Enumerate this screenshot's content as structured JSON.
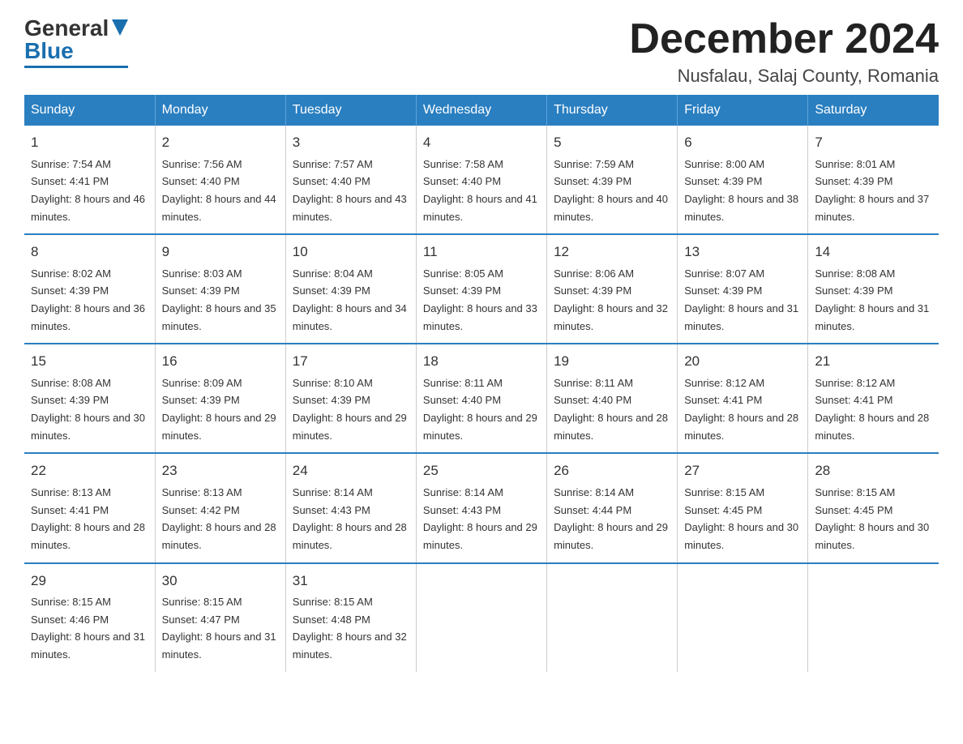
{
  "logo": {
    "general": "General",
    "blue": "Blue"
  },
  "title": "December 2024",
  "subtitle": "Nusfalau, Salaj County, Romania",
  "days_of_week": [
    "Sunday",
    "Monday",
    "Tuesday",
    "Wednesday",
    "Thursday",
    "Friday",
    "Saturday"
  ],
  "weeks": [
    [
      {
        "day": "1",
        "sunrise": "7:54 AM",
        "sunset": "4:41 PM",
        "daylight": "8 hours and 46 minutes."
      },
      {
        "day": "2",
        "sunrise": "7:56 AM",
        "sunset": "4:40 PM",
        "daylight": "8 hours and 44 minutes."
      },
      {
        "day": "3",
        "sunrise": "7:57 AM",
        "sunset": "4:40 PM",
        "daylight": "8 hours and 43 minutes."
      },
      {
        "day": "4",
        "sunrise": "7:58 AM",
        "sunset": "4:40 PM",
        "daylight": "8 hours and 41 minutes."
      },
      {
        "day": "5",
        "sunrise": "7:59 AM",
        "sunset": "4:39 PM",
        "daylight": "8 hours and 40 minutes."
      },
      {
        "day": "6",
        "sunrise": "8:00 AM",
        "sunset": "4:39 PM",
        "daylight": "8 hours and 38 minutes."
      },
      {
        "day": "7",
        "sunrise": "8:01 AM",
        "sunset": "4:39 PM",
        "daylight": "8 hours and 37 minutes."
      }
    ],
    [
      {
        "day": "8",
        "sunrise": "8:02 AM",
        "sunset": "4:39 PM",
        "daylight": "8 hours and 36 minutes."
      },
      {
        "day": "9",
        "sunrise": "8:03 AM",
        "sunset": "4:39 PM",
        "daylight": "8 hours and 35 minutes."
      },
      {
        "day": "10",
        "sunrise": "8:04 AM",
        "sunset": "4:39 PM",
        "daylight": "8 hours and 34 minutes."
      },
      {
        "day": "11",
        "sunrise": "8:05 AM",
        "sunset": "4:39 PM",
        "daylight": "8 hours and 33 minutes."
      },
      {
        "day": "12",
        "sunrise": "8:06 AM",
        "sunset": "4:39 PM",
        "daylight": "8 hours and 32 minutes."
      },
      {
        "day": "13",
        "sunrise": "8:07 AM",
        "sunset": "4:39 PM",
        "daylight": "8 hours and 31 minutes."
      },
      {
        "day": "14",
        "sunrise": "8:08 AM",
        "sunset": "4:39 PM",
        "daylight": "8 hours and 31 minutes."
      }
    ],
    [
      {
        "day": "15",
        "sunrise": "8:08 AM",
        "sunset": "4:39 PM",
        "daylight": "8 hours and 30 minutes."
      },
      {
        "day": "16",
        "sunrise": "8:09 AM",
        "sunset": "4:39 PM",
        "daylight": "8 hours and 29 minutes."
      },
      {
        "day": "17",
        "sunrise": "8:10 AM",
        "sunset": "4:39 PM",
        "daylight": "8 hours and 29 minutes."
      },
      {
        "day": "18",
        "sunrise": "8:11 AM",
        "sunset": "4:40 PM",
        "daylight": "8 hours and 29 minutes."
      },
      {
        "day": "19",
        "sunrise": "8:11 AM",
        "sunset": "4:40 PM",
        "daylight": "8 hours and 28 minutes."
      },
      {
        "day": "20",
        "sunrise": "8:12 AM",
        "sunset": "4:41 PM",
        "daylight": "8 hours and 28 minutes."
      },
      {
        "day": "21",
        "sunrise": "8:12 AM",
        "sunset": "4:41 PM",
        "daylight": "8 hours and 28 minutes."
      }
    ],
    [
      {
        "day": "22",
        "sunrise": "8:13 AM",
        "sunset": "4:41 PM",
        "daylight": "8 hours and 28 minutes."
      },
      {
        "day": "23",
        "sunrise": "8:13 AM",
        "sunset": "4:42 PM",
        "daylight": "8 hours and 28 minutes."
      },
      {
        "day": "24",
        "sunrise": "8:14 AM",
        "sunset": "4:43 PM",
        "daylight": "8 hours and 28 minutes."
      },
      {
        "day": "25",
        "sunrise": "8:14 AM",
        "sunset": "4:43 PM",
        "daylight": "8 hours and 29 minutes."
      },
      {
        "day": "26",
        "sunrise": "8:14 AM",
        "sunset": "4:44 PM",
        "daylight": "8 hours and 29 minutes."
      },
      {
        "day": "27",
        "sunrise": "8:15 AM",
        "sunset": "4:45 PM",
        "daylight": "8 hours and 30 minutes."
      },
      {
        "day": "28",
        "sunrise": "8:15 AM",
        "sunset": "4:45 PM",
        "daylight": "8 hours and 30 minutes."
      }
    ],
    [
      {
        "day": "29",
        "sunrise": "8:15 AM",
        "sunset": "4:46 PM",
        "daylight": "8 hours and 31 minutes."
      },
      {
        "day": "30",
        "sunrise": "8:15 AM",
        "sunset": "4:47 PM",
        "daylight": "8 hours and 31 minutes."
      },
      {
        "day": "31",
        "sunrise": "8:15 AM",
        "sunset": "4:48 PM",
        "daylight": "8 hours and 32 minutes."
      },
      null,
      null,
      null,
      null
    ]
  ]
}
